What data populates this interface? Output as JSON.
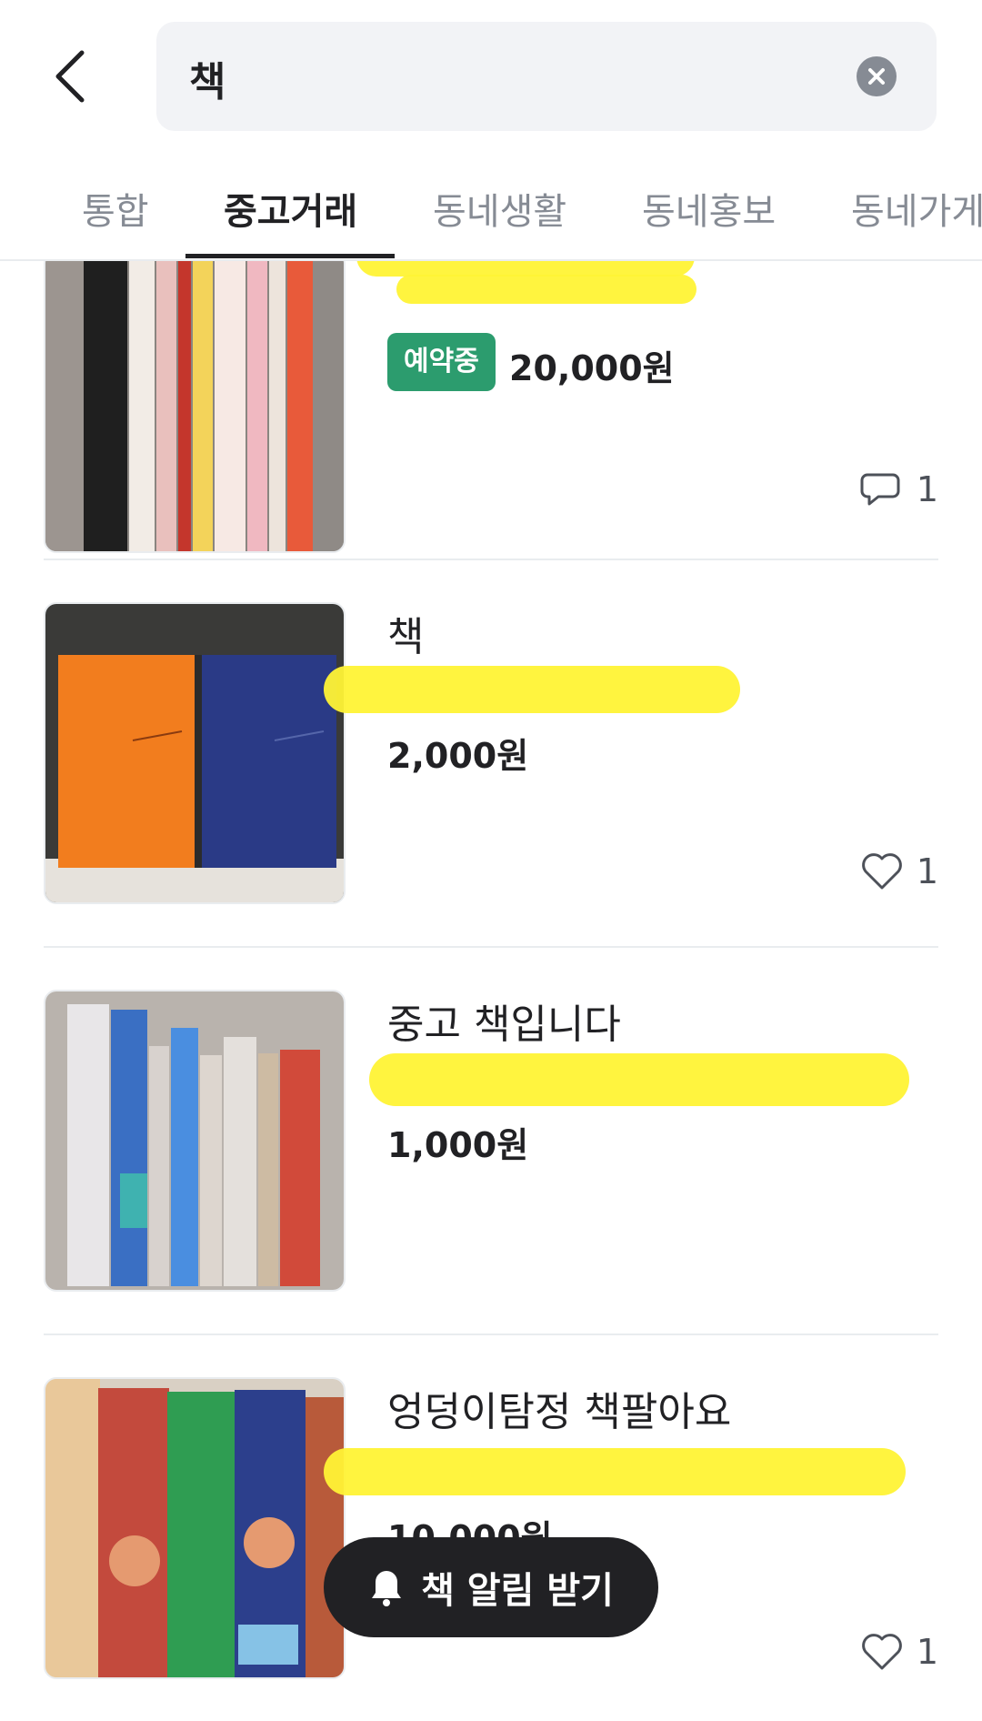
{
  "search": {
    "query": "책"
  },
  "tabs": [
    {
      "label": "통합"
    },
    {
      "label": "중고거래",
      "active": true
    },
    {
      "label": "동네생활"
    },
    {
      "label": "동네홍보"
    },
    {
      "label": "동네가게"
    }
  ],
  "items": [
    {
      "title": "",
      "subinfo": "",
      "status_badge": "예약중",
      "price": "20,000원",
      "meta_icon": "chat-icon",
      "meta_count": "1"
    },
    {
      "title": "책",
      "subinfo": "",
      "status_badge": "",
      "price": "2,000원",
      "meta_icon": "heart-icon",
      "meta_count": "1"
    },
    {
      "title": "중고 책입니다",
      "subinfo": "",
      "status_badge": "",
      "price": "1,000원",
      "meta_icon": "",
      "meta_count": ""
    },
    {
      "title": "엉덩이탐정 책팔아요",
      "subinfo": "",
      "status_badge": "",
      "price": "10,000원",
      "meta_icon": "heart-icon",
      "meta_count": "1"
    }
  ],
  "floating_button": {
    "label": "책 알림 받기",
    "icon": "bell-icon"
  },
  "colors": {
    "badge": "#2c9c6e",
    "highlight": "#fff335",
    "pill": "#212124"
  }
}
